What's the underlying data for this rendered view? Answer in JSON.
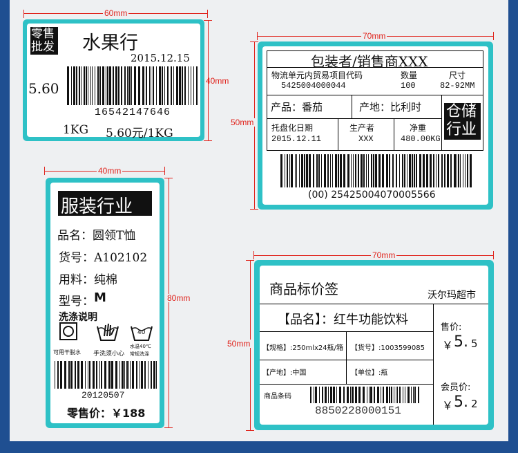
{
  "dims": {
    "d1": "60mm",
    "d2": "40mm",
    "d3": "70mm",
    "d4": "50mm",
    "d5": "40mm",
    "d6": "80mm",
    "d7": "70mm",
    "d8": "50mm"
  },
  "label1": {
    "badge_line1": "零售",
    "badge_line2": "批发",
    "shop": "水果行",
    "date": "2015.12.15",
    "price_left": "5.60",
    "code": "16542147646",
    "weight": "1KG",
    "unit_price": "5.60元/1KG"
  },
  "label2": {
    "title": "包装者/销售商XXX",
    "code_head": "物流单元内贸易项目代码",
    "code_val": "5425004000044",
    "qty_head": "数量",
    "qty_val": "100",
    "size_head": "尺寸",
    "size_val": "82-92MM",
    "product": "产品：番茄",
    "origin": "产地：比利时",
    "stamp_line1": "仓储",
    "stamp_line2": "行业",
    "pallet_head": "托盘化日期",
    "pallet_val": "2015.12.11",
    "maker_head": "生产者",
    "maker_val": "XXX",
    "net_head": "净重",
    "net_val": "480.00KG",
    "barcode_text": "(00) 25425004070005566"
  },
  "label3": {
    "title": "服装行业",
    "name": "品名：圆领T恤",
    "item_no": "货号：A102102",
    "material": "用料：纯棉",
    "model_key": "型号：",
    "model_val": "M",
    "wash_title": "洗涤说明",
    "icon1_text": "可用干脱水",
    "icon2_text": "手洗须小心",
    "icon3_num": "40",
    "icon3_text1": "水温40℃",
    "icon3_text2": "常规洗涤",
    "code": "20120507",
    "price": "零售价：￥188"
  },
  "label4": {
    "title": "商品标价签",
    "store": "沃尔玛超市",
    "name": "【品名】：红牛功能饮料",
    "spec": "【规格】:250mlx24瓶/箱",
    "item_no": "【货号】:1003599085",
    "origin": "【产地】:中国",
    "unit": "【单位】:瓶",
    "barcode_head": "商品条码",
    "barcode_num": "8850228000151",
    "price_label": "售价:",
    "price_sym": "￥",
    "price_int": "5.",
    "price_dec": "5",
    "member_label": "会员价:",
    "member_sym": "￥",
    "member_int": "5.",
    "member_dec": "2"
  }
}
